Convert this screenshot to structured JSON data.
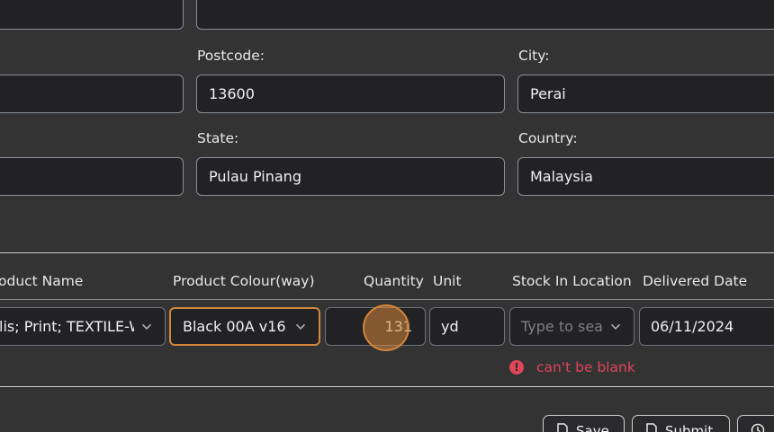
{
  "address": {
    "postcode_label": "Postcode:",
    "postcode_value": "13600",
    "city_label": "City:",
    "city_value": "Perai",
    "state_label": "State:",
    "state_value": "Pulau Pinang",
    "country_label": "Country:",
    "country_value": "Malaysia"
  },
  "items_table": {
    "headers": {
      "product_name": "oduct Name",
      "product_colour": "Product Colour(way)",
      "quantity": "Quantity",
      "unit": "Unit",
      "stock_in_location": "Stock In Location",
      "delivered_date": "Delivered Date"
    },
    "row": {
      "product_name": "lis; Print; TEXTILE-W",
      "product_colour": "Black 00A v16",
      "quantity": "131",
      "unit": "yd",
      "stock_in_location_placeholder": "Type to sea",
      "delivered_date": "06/11/2024"
    },
    "error": "can't be blank"
  },
  "actions": {
    "save_label": "Save",
    "submit_label": "Submit"
  },
  "colors": {
    "background": "#333334",
    "field_bg": "#222225",
    "focus_border": "#d4863a",
    "error": "#e0455a"
  }
}
